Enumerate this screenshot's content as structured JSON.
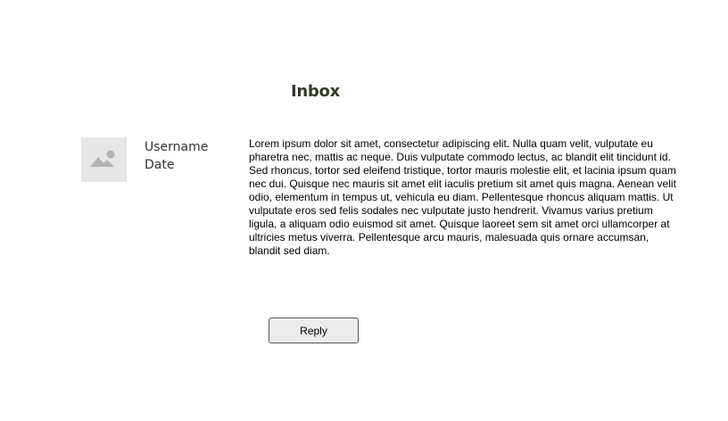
{
  "page": {
    "title": "Inbox"
  },
  "message": {
    "avatar_icon": "image-placeholder-icon",
    "username": "Username",
    "date": "Date",
    "body": "Lorem ipsum dolor sit amet, consectetur adipiscing elit. Nulla quam velit, vulputate eu pharetra nec, mattis ac neque. Duis vulputate commodo lectus, ac blandit elit tincidunt id. Sed rhoncus, tortor sed eleifend tristique, tortor mauris molestie elit, et lacinia ipsum quam nec dui. Quisque nec mauris sit amet elit iaculis pretium sit amet quis magna. Aenean velit odio, elementum in tempus ut, vehicula eu diam. Pellentesque rhoncus aliquam mattis. Ut vulputate eros sed felis sodales nec vulputate justo hendrerit. Vivamus varius pretium ligula, a aliquam odio euismod sit amet. Quisque laoreet sem sit amet orci ullamcorper at ultricies metus viverra. Pellentesque arcu mauris, malesuada quis ornare accumsan, blandit sed diam."
  },
  "actions": {
    "reply_label": "Reply"
  },
  "colors": {
    "title": "#333a2a",
    "avatar_bg": "#e6e6e6",
    "avatar_glyph": "#b3b3b3",
    "button_bg": "#ececec",
    "button_border": "#555555"
  }
}
